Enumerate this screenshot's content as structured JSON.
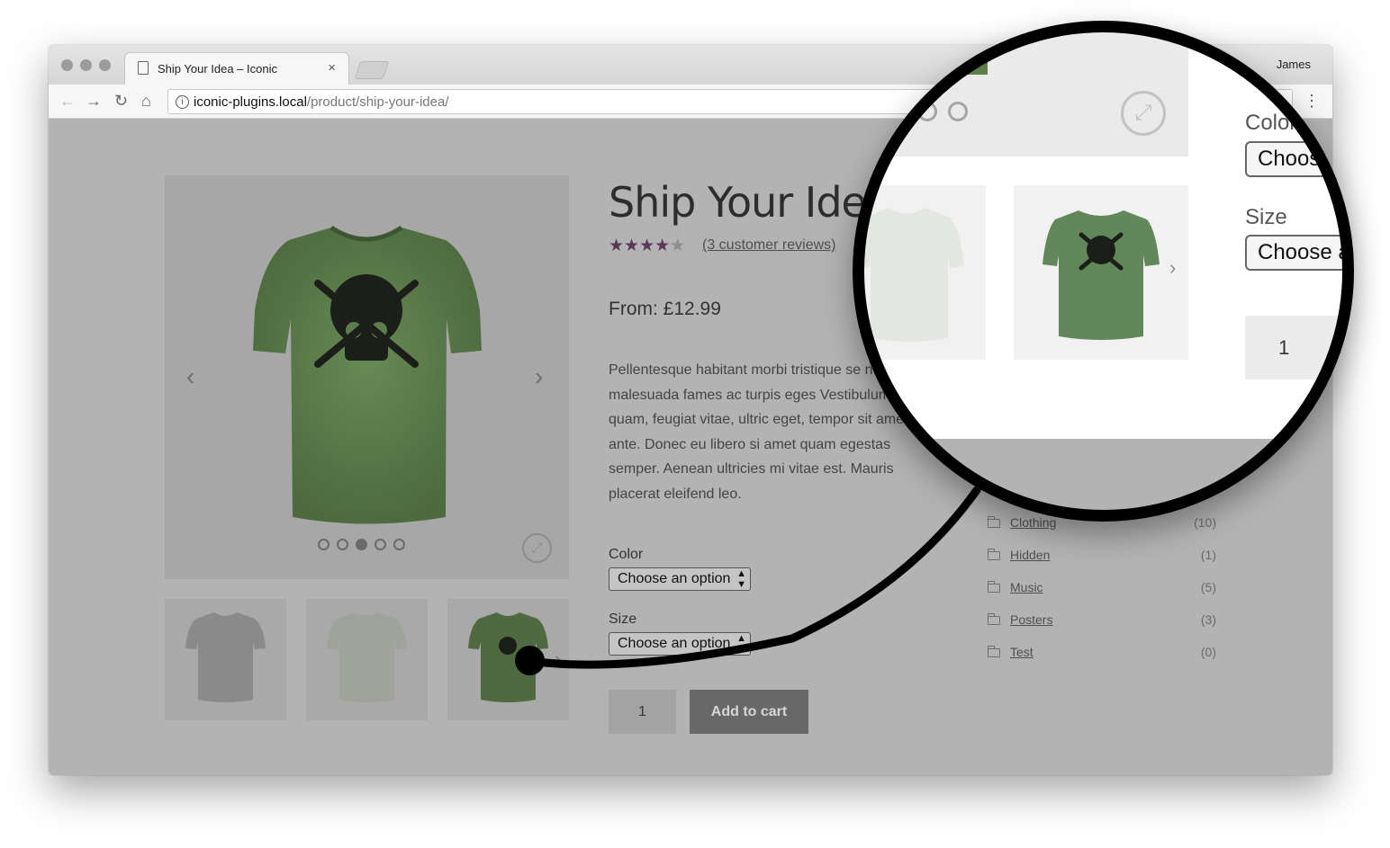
{
  "browser": {
    "tab_title": "Ship Your Idea – Iconic",
    "tab_close": "×",
    "profile_name": "James",
    "url_host": "iconic-plugins.local",
    "url_path": "/product/ship-your-idea/",
    "nav": {
      "back": "←",
      "forward": "→",
      "reload": "↻",
      "home": "⌂",
      "menu": "⋮",
      "info": "i"
    }
  },
  "product": {
    "title": "Ship Your Idea",
    "rating": 4.5,
    "rating_max": 5,
    "stars_on": "★★★★",
    "stars_off": "★",
    "reviews_link": "(3 customer reviews)",
    "price": "From: £12.99",
    "description": "Pellentesque habitant morbi tristique se netus et malesuada fames ac turpis eges Vestibulum tortor quam, feugiat vitae, ultric eget, tempor sit amet, ante. Donec eu libero si amet quam egestas semper. Aenean ultricies mi vitae est. Mauris placerat eleifend leo.",
    "color_label": "Color",
    "color_select": "Choose an option",
    "size_label": "Size",
    "size_select": "Choose an option",
    "quantity": "1",
    "add_to_cart": "Add to cart",
    "gallery_prev": "‹",
    "gallery_next": "›",
    "gallery_slide_count": 5,
    "gallery_active_slide": 3,
    "thumb_next": "›"
  },
  "categories": [
    {
      "name": "Clothing",
      "count": "(10)"
    },
    {
      "name": "Hidden",
      "count": "(1)"
    },
    {
      "name": "Music",
      "count": "(5)"
    },
    {
      "name": "Posters",
      "count": "(3)"
    },
    {
      "name": "Test",
      "count": "(0)"
    }
  ],
  "magnifier": {
    "color_label": "Color",
    "color_select": "Choose",
    "size_label": "Size",
    "size_select": "Choose an",
    "quantity": "1",
    "next_arrow": "›"
  },
  "colors": {
    "page_overlay": "#b3b3b3",
    "shirt_green": "#5d7d4c",
    "star_purple": "#5b3859",
    "button_grey": "#686868"
  }
}
